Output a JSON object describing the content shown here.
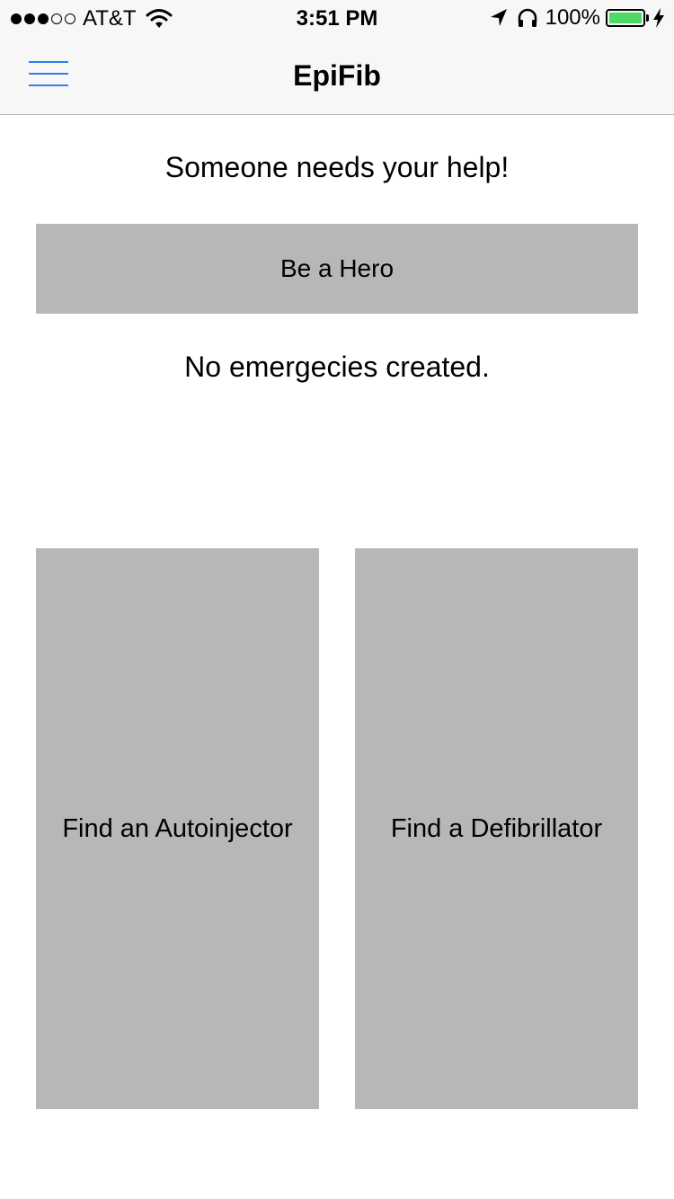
{
  "status_bar": {
    "carrier": "AT&T",
    "time": "3:51 PM",
    "battery_percent": "100%",
    "signal_bars_filled": 3,
    "signal_bars_total": 5,
    "battery_color": "#4cd964",
    "icons": [
      "wifi-icon",
      "location-arrow-icon",
      "headphones-icon",
      "battery-icon",
      "charging-bolt-icon"
    ]
  },
  "nav": {
    "title": "EpiFib",
    "menu_icon": "hamburger-menu-icon",
    "accent_color": "#2f7ff0"
  },
  "main": {
    "help_heading": "Someone needs your help!",
    "hero_button_label": "Be a Hero",
    "emergency_status": "No emergecies created.",
    "find_autoinjector_label": "Find an Autoinjector",
    "find_defibrillator_label": "Find a Defibrillator",
    "button_color": "#b7b7b7"
  }
}
